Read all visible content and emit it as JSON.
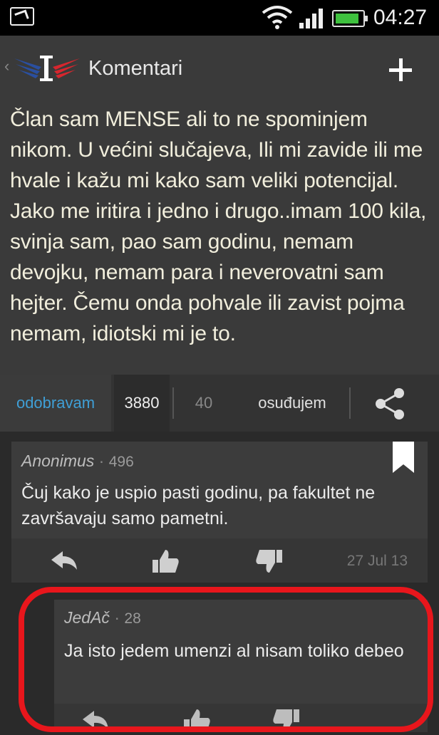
{
  "status_bar": {
    "time": "04:27",
    "icons": [
      "notification-icon",
      "wifi-icon",
      "signal-icon",
      "battery-icon"
    ],
    "battery_color": "#3ec13e"
  },
  "app_bar": {
    "title": "Komentari",
    "back_glyph": "‹",
    "logo_colors": [
      "#2a4fa0",
      "#ffffff",
      "#d8262e"
    ]
  },
  "post": {
    "text": "Član sam MENSE ali to ne spominjem nikom. U većini slučajeva, Ili mi  zavide ili me hvale i kažu mi kako sam veliki potencijal. Jako me iritira i jedno i drugo..imam 100 kila, svinja sam, pao sam godinu, nemam devojku, nemam para i neverovatni sam hejter. Čemu onda pohvale ili zavist pojma nemam, idiotski mi je to.",
    "approve_label": "odobravam",
    "approve_count": "3880",
    "condemn_count": "40",
    "condemn_label": "osuđujem"
  },
  "comments": [
    {
      "author": "Anonimus",
      "separator": "·",
      "score": "496",
      "text": "Čuj kako je uspio pasti godinu, pa fakultet ne završavaju samo pametni.",
      "date": "27 Jul 13"
    },
    {
      "author": "JedAč",
      "separator": "·",
      "score": "28",
      "text": "Ja isto jedem umenzi al nisam toliko debeo"
    }
  ],
  "colors": {
    "accent_blue": "#3f9fd6",
    "highlight_red": "#e8161c",
    "post_text": "#f1eedc"
  }
}
